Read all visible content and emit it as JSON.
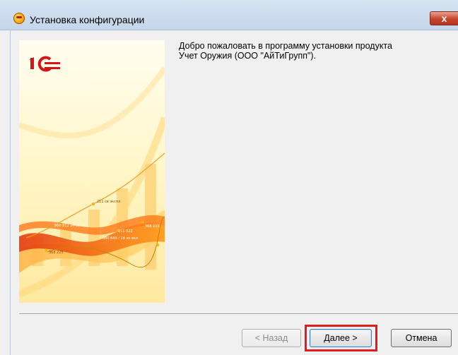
{
  "window": {
    "title": "Установка конфигурации",
    "close_label": "x"
  },
  "banner": {
    "logo_text": "1С",
    "chart_labels": [
      "211 св экспл",
      "860 212 24 со сч",
      "211 022",
      "368 225",
      "680 640 / 14 из вкл",
      "368 225"
    ]
  },
  "welcome": {
    "line1": "Добро пожаловать в программу установки продукта",
    "line2": "Учет Оружия (ООО \"АйТиГрупп\")."
  },
  "buttons": {
    "back": "< Назад",
    "next": "Далее >",
    "cancel": "Отмена"
  },
  "colors": {
    "title_bar": "#c9daec",
    "close_button": "#c7432b",
    "highlight": "#e21c1c",
    "logo_red": "#d7141a"
  },
  "icons": {
    "app": "1c-app-icon",
    "close": "close-icon"
  }
}
